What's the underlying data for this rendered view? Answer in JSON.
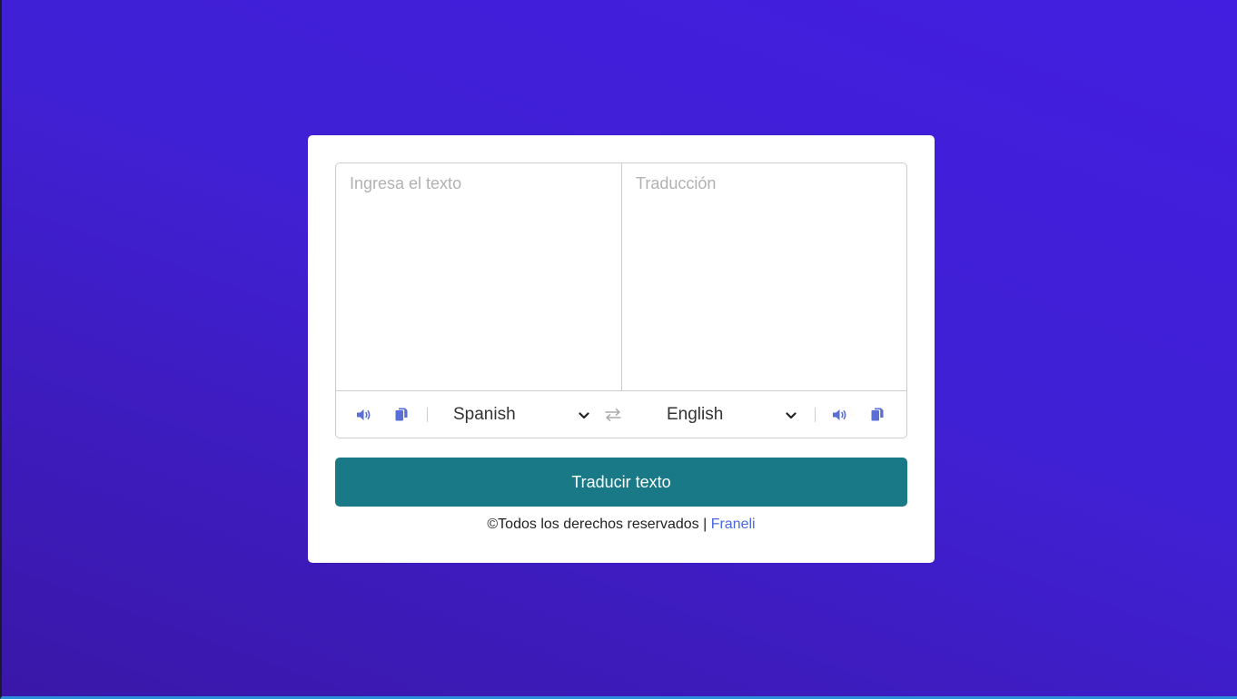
{
  "from": {
    "placeholder": "Ingresa el texto",
    "language": "Spanish",
    "speak_icon": "volume-icon",
    "copy_icon": "copy-icon"
  },
  "to": {
    "placeholder": "Traducción",
    "language": "English",
    "speak_icon": "volume-icon",
    "copy_icon": "copy-icon"
  },
  "exchange_icon": "exchange-icon",
  "translate_button": "Traducir texto",
  "footer": {
    "text": "©Todos los derechos reservados | ",
    "link": "Franeli"
  },
  "colors": {
    "background_start": "#3a17a8",
    "background_end": "#421ee0",
    "button": "#1a7987",
    "icon": "#5a6fd6",
    "link": "#4968e0"
  }
}
